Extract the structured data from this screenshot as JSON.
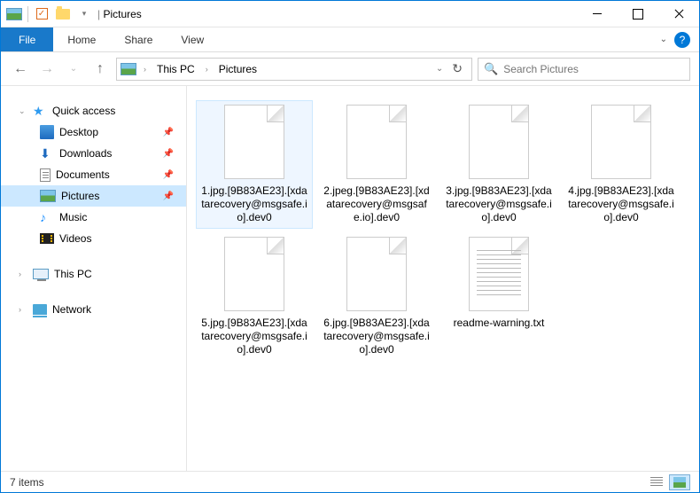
{
  "titlebar": {
    "title": "Pictures"
  },
  "ribbon": {
    "file": "File",
    "tabs": [
      "Home",
      "Share",
      "View"
    ]
  },
  "breadcrumb": {
    "root": "This PC",
    "current": "Pictures"
  },
  "search": {
    "placeholder": "Search Pictures"
  },
  "nav": {
    "quick_access": "Quick access",
    "items": [
      {
        "label": "Desktop",
        "icon": "ico-desktop",
        "pinned": true
      },
      {
        "label": "Downloads",
        "icon": "ico-downloads",
        "pinned": true
      },
      {
        "label": "Documents",
        "icon": "ico-docs",
        "pinned": true
      },
      {
        "label": "Pictures",
        "icon": "ico-pictures",
        "pinned": true,
        "selected": true
      },
      {
        "label": "Music",
        "icon": "ico-music",
        "pinned": false
      },
      {
        "label": "Videos",
        "icon": "ico-videos",
        "pinned": false
      }
    ],
    "this_pc": "This PC",
    "network": "Network"
  },
  "files": [
    {
      "name": "1.jpg.[9B83AE23].[xdatarecovery@msgsafe.io].dev0",
      "type": "blank",
      "selected": true
    },
    {
      "name": "2.jpeg.[9B83AE23].[xdatarecovery@msgsafe.io].dev0",
      "type": "blank"
    },
    {
      "name": "3.jpg.[9B83AE23].[xdatarecovery@msgsafe.io].dev0",
      "type": "blank"
    },
    {
      "name": "4.jpg.[9B83AE23].[xdatarecovery@msgsafe.io].dev0",
      "type": "blank"
    },
    {
      "name": "5.jpg.[9B83AE23].[xdatarecovery@msgsafe.io].dev0",
      "type": "blank"
    },
    {
      "name": "6.jpg.[9B83AE23].[xdatarecovery@msgsafe.io].dev0",
      "type": "blank"
    },
    {
      "name": "readme-warning.txt",
      "type": "txt"
    }
  ],
  "status": {
    "text": "7 items"
  }
}
